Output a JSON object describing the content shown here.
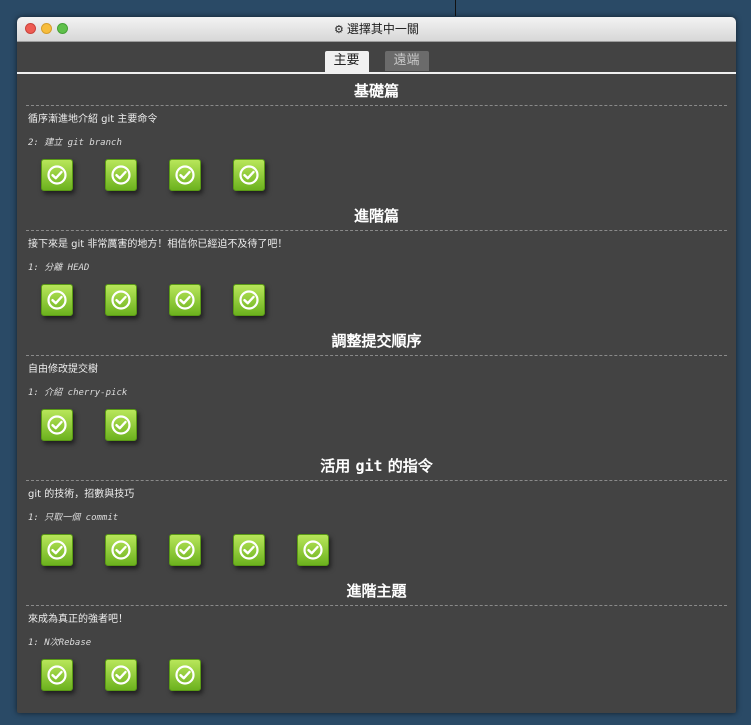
{
  "window": {
    "title": "選擇其中一關"
  },
  "tabs": [
    {
      "label": "主要",
      "active": true
    },
    {
      "label": "遠端",
      "active": false
    }
  ],
  "sections": [
    {
      "title": "基礎篇",
      "description": "循序漸進地介紹 git 主要命令",
      "current_level": "2: 建立 git branch",
      "levels_completed": [
        true,
        true,
        true,
        true
      ]
    },
    {
      "title": "進階篇",
      "description": "接下來是 git 非常厲害的地方！相信你已經迫不及待了吧！",
      "current_level": "1: 分離 HEAD",
      "levels_completed": [
        true,
        true,
        true,
        true
      ]
    },
    {
      "title": "調整提交順序",
      "description": "自由修改提交樹",
      "current_level": "1: 介紹 cherry-pick",
      "levels_completed": [
        true,
        true
      ]
    },
    {
      "title_prefix": "活用 ",
      "title_code": "git",
      "title_suffix": " 的指令",
      "description": "git 的技術，招數與技巧",
      "current_level": "1: 只取一個 commit",
      "levels_completed": [
        true,
        true,
        true,
        true,
        true
      ]
    },
    {
      "title": "進階主題",
      "description": "來成為真正的強者吧！",
      "current_level": "1: N次Rebase",
      "levels_completed": [
        true,
        true,
        true
      ]
    }
  ],
  "icons": {
    "level": "check-circle-icon",
    "settings": "gear-icon"
  },
  "colors": {
    "background": "#2a4a66",
    "panel": "#434343",
    "level_button": "#8cc63a"
  }
}
